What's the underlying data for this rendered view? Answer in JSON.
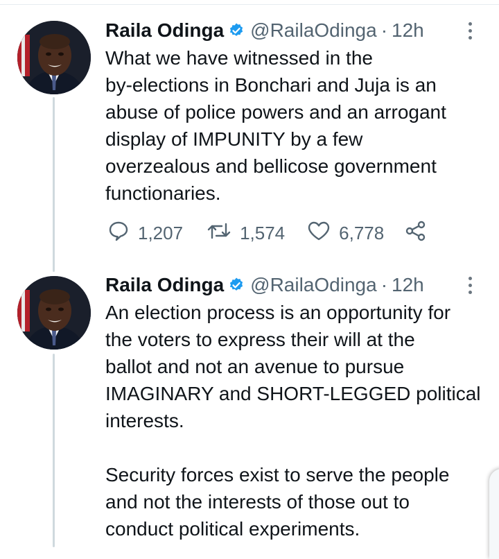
{
  "tweets": [
    {
      "author_name": "Raila Odinga",
      "handle": "@RailaOdinga",
      "separator": "·",
      "time": "12h",
      "text": "What we have witnessed in the\nby-elections in Bonchari and Juja is an\nabuse of police powers and an arrogant\ndisplay of IMPUNITY by a few\noverzealous and bellicose government\nfunctionaries.",
      "replies": "1,207",
      "retweets": "1,574",
      "likes": "6,778"
    },
    {
      "author_name": "Raila Odinga",
      "handle": "@RailaOdinga",
      "separator": "·",
      "time": "12h",
      "text": "An election process is an opportunity for\nthe voters to express their will at the\nballot and not an avenue to pursue\nIMAGINARY and SHORT-LEGGED political\ninterests.\n\nSecurity forces exist to serve the people\nand not the interests of those out to\nconduct political experiments."
    }
  ],
  "icons": {
    "verified": "verified-badge-icon",
    "menu": "more-vertical-icon",
    "reply": "reply-icon",
    "retweet": "retweet-icon",
    "like": "heart-icon",
    "share": "share-icon"
  },
  "colors": {
    "verified_blue": "#1d9bf0",
    "icon_gray": "#536471",
    "thread_line": "#cfd9de"
  }
}
